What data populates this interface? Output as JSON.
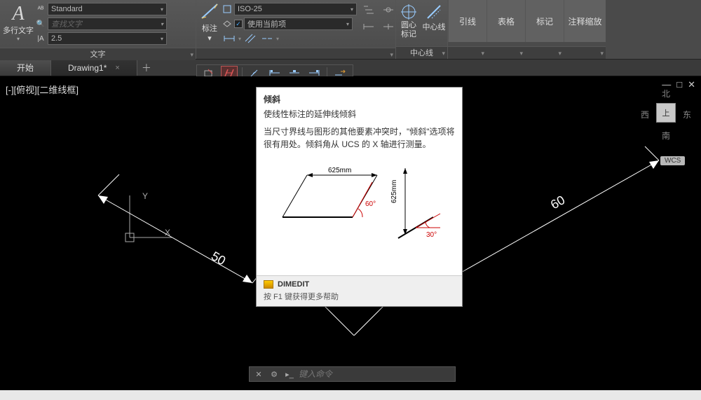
{
  "ribbon": {
    "text_panel": {
      "big_label": "多行文字",
      "style_combo": "Standard",
      "find_placeholder": "查找文字",
      "height": "2.5",
      "title": "文字"
    },
    "dim_panel": {
      "big_label": "标注",
      "style_combo": "ISO-25",
      "use_current_label": "使用当前项",
      "title": ""
    },
    "center_panel": {
      "circle_label": "圆心\n标记",
      "line_label": "中心线",
      "title": "中心线"
    },
    "right_btns": {
      "leader": "引线",
      "table": "表格",
      "markup": "标记",
      "annoscale": "注释缩放"
    }
  },
  "tabs": {
    "start": "开始",
    "drawing": "Drawing1*"
  },
  "viewport_label": "[-][俯视][二维线框]",
  "ucs": {
    "x": "X",
    "y": "Y"
  },
  "dims": {
    "left": "50",
    "right": "60"
  },
  "viewcube": {
    "n": "北",
    "s": "南",
    "e": "东",
    "w": "西",
    "face": "上",
    "wcs": "WCS"
  },
  "tooltip": {
    "title": "倾斜",
    "subtitle": "使线性标注的延伸线倾斜",
    "description": "当尺寸界线与图形的其他要素冲突时，\"倾斜\"选项将很有用处。倾斜角从 UCS 的 X 轴进行测量。",
    "fig": {
      "len": "625mm",
      "a1": "60°",
      "vert": "625mm",
      "a2": "30°"
    },
    "command": "DIMEDIT",
    "help": "按 F1 键获得更多帮助"
  },
  "cmdline_placeholder": "键入命令"
}
